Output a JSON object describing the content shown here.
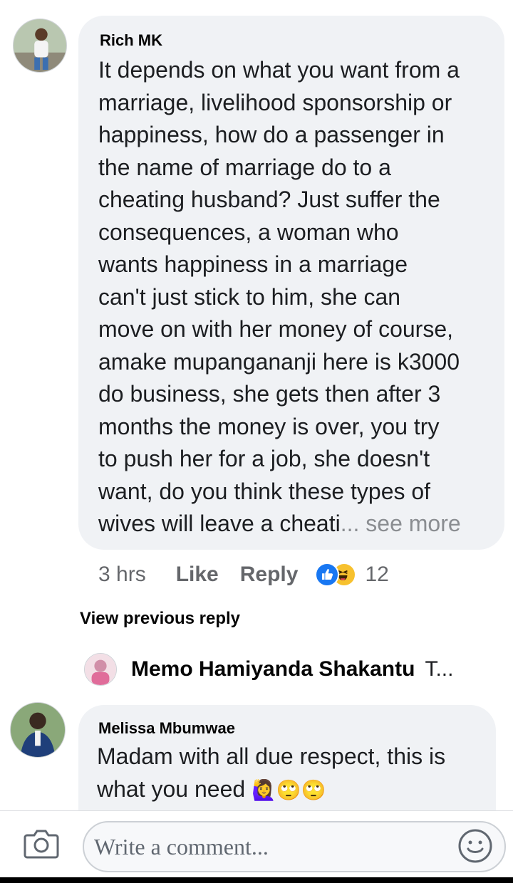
{
  "comment": {
    "author": "Rich MK",
    "lines": [
      "It depends on what you want from a",
      "marriage, livelihood sponsorship or",
      "happiness, how do a passenger in",
      "the name of marriage do to a",
      "cheating husband? Just suffer the",
      "consequences, a woman who",
      "wants happiness in a marriage",
      "can't just stick to him, she can",
      "move on with her money of course,",
      "amake mupangananji here is k3000",
      "do business, she gets then after 3",
      "months the money is over, you try",
      "to push her for a job, she doesn't",
      "want, do you think these types of"
    ],
    "last_line": "wives will leave a cheati",
    "see_more": "... see more",
    "time": "3 hrs",
    "like_label": "Like",
    "reply_label": "Reply",
    "reaction_count": "12"
  },
  "view_previous": "View previous reply",
  "reply_preview": {
    "name": "Memo Hamiyanda Shakantu",
    "text": "T..."
  },
  "reply": {
    "author": "Melissa Mbumwae",
    "line1": "Madam with all due respect, this is",
    "line2": "what you need",
    "emojis": "🙋‍♀️🙄🙄"
  },
  "composer": {
    "placeholder": "Write a comment..."
  }
}
